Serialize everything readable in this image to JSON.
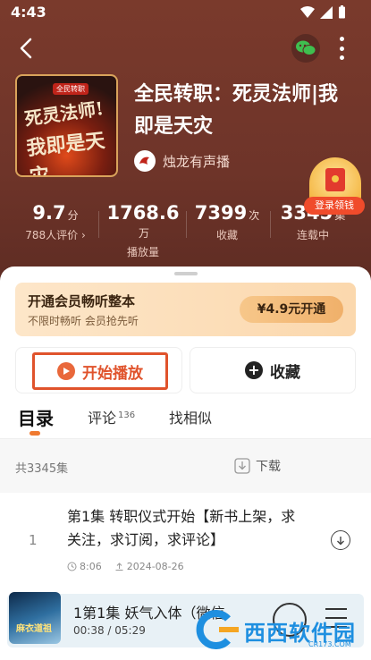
{
  "status_bar": {
    "time": "4:43"
  },
  "book": {
    "title": "全民转职：死灵法师|我即是天灾",
    "publisher": "烛龙有声播",
    "cover_text_line1": "死灵法师!",
    "cover_text_line2": "我即是天灾"
  },
  "stats": [
    {
      "value": "9.7",
      "unit": "分",
      "label": "788人评价 ›"
    },
    {
      "value": "1768.6",
      "unit": "万",
      "label": "播放量"
    },
    {
      "value": "7399",
      "unit": "次",
      "label": "收藏"
    },
    {
      "value": "3345",
      "unit": "集",
      "label": "连载中"
    }
  ],
  "vip": {
    "title": "开通会员畅听整本",
    "subtitle": "不限时畅听 会员抢先听",
    "button": "¥4.9元开通"
  },
  "actions": {
    "play": "开始播放",
    "favorite": "收藏"
  },
  "tabs": [
    {
      "label": "目录",
      "count": ""
    },
    {
      "label": "评论",
      "count": "136"
    },
    {
      "label": "找相似",
      "count": ""
    }
  ],
  "catalog": {
    "total": "共3345集",
    "download": "下载"
  },
  "reward": {
    "label": "登录领钱"
  },
  "episodes": [
    {
      "number": "1",
      "title": "第1集  转职仪式开始【新书上架，求关注，求订阅，求评论】",
      "duration": "8:06",
      "date": "2024-08-26"
    }
  ],
  "mini_player": {
    "title": "1第1集 妖气入体（微信",
    "time": "00:38 / 05:29",
    "cover_text": "麻衣道祖"
  },
  "watermark": {
    "text": "西西软件园",
    "url": "CR173.COM"
  },
  "colors": {
    "hero_bg": "#7a3a2c",
    "accent": "#e0532c",
    "vip_bg": "#fbd8ad"
  }
}
